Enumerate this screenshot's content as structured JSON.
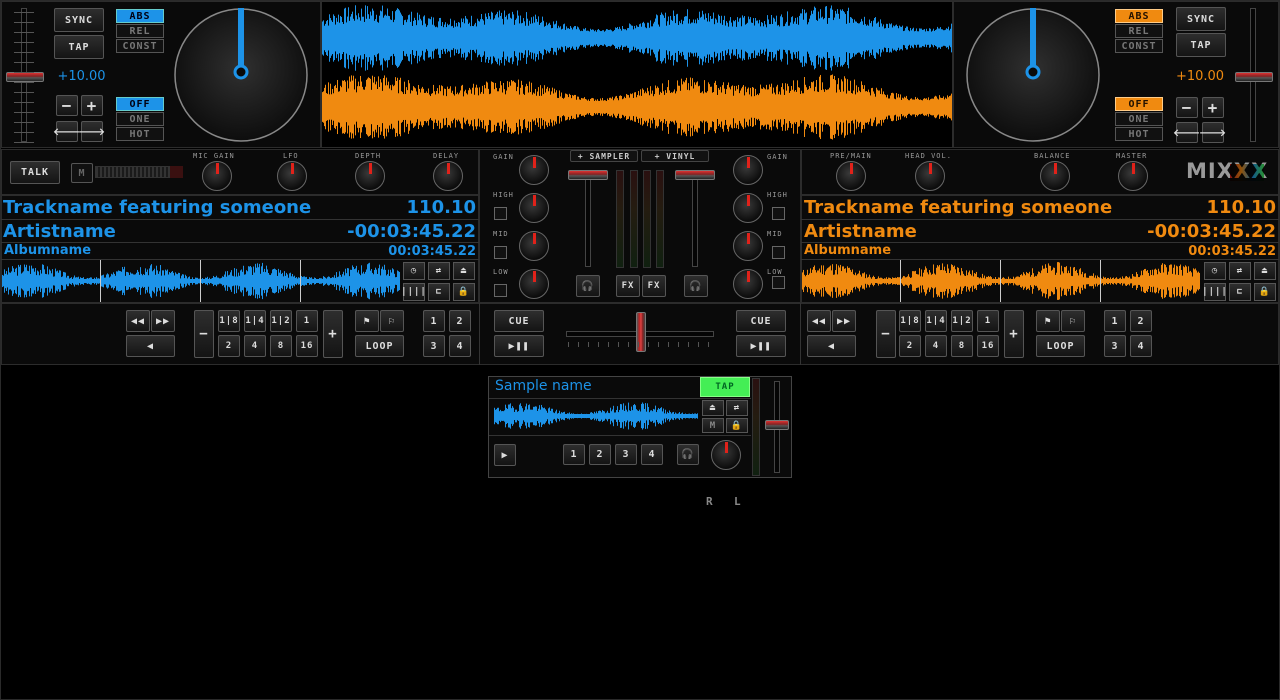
{
  "app": {
    "logo": "MIXXX"
  },
  "colors": {
    "deck1": "#1d93e8",
    "deck2": "#f08a10",
    "tap_green": "#44ee55"
  },
  "deck1": {
    "sync_label": "SYNC",
    "tap_label": "TAP",
    "rate_modes": [
      "ABS",
      "REL",
      "CONST"
    ],
    "rate_mode_active": "ABS",
    "pitch_value": "+10.00",
    "cue_modes": [
      "OFF",
      "ONE",
      "HOT"
    ],
    "cue_mode_active": "OFF",
    "minus": "−",
    "plus": "+",
    "track": "Trackname featuring someone",
    "bpm": "110.10",
    "artist": "Artistname",
    "time_remaining": "-00:03:45.22",
    "album": "Albumname",
    "time_total": "00:03:45.22",
    "cue_label": "CUE",
    "beatloop_top": [
      "1|8",
      "1|4",
      "1|2",
      "1"
    ],
    "beatloop_bottom": [
      "2",
      "4",
      "8",
      "16"
    ],
    "loop_label": "LOOP",
    "hotcues": [
      "1",
      "2",
      "3",
      "4"
    ]
  },
  "deck2": {
    "sync_label": "SYNC",
    "tap_label": "TAP",
    "rate_modes": [
      "ABS",
      "REL",
      "CONST"
    ],
    "rate_mode_active": "ABS",
    "pitch_value": "+10.00",
    "cue_modes": [
      "OFF",
      "ONE",
      "HOT"
    ],
    "cue_mode_active": "OFF",
    "minus": "−",
    "plus": "+",
    "track": "Trackname featuring someone",
    "bpm": "110.10",
    "artist": "Artistname",
    "time_remaining": "-00:03:45.22",
    "album": "Albumname",
    "time_total": "00:03:45.22",
    "cue_label": "CUE",
    "beatloop_top": [
      "1|8",
      "1|4",
      "1|2",
      "1"
    ],
    "beatloop_bottom": [
      "2",
      "4",
      "8",
      "16"
    ],
    "loop_label": "LOOP",
    "hotcues": [
      "1",
      "2",
      "3",
      "4"
    ]
  },
  "mic": {
    "talk_label": "TALK",
    "m_label": "M",
    "knobs": [
      "MIC GAIN",
      "LFO",
      "DEPTH",
      "DELAY"
    ]
  },
  "master": {
    "knobs": [
      "PRE/MAIN",
      "HEAD VOL.",
      "BALANCE",
      "MASTER"
    ]
  },
  "mixer": {
    "sampler_toggle": "+ SAMPLER",
    "vinyl_toggle": "+ VINYL",
    "left_labels": [
      "GAIN",
      "HIGH",
      "MID",
      "LOW"
    ],
    "right_labels": [
      "GAIN",
      "HIGH",
      "MID",
      "LOW"
    ],
    "fx_label": "FX"
  },
  "sampler": {
    "name": "Sample name",
    "tap_label": "TAP",
    "m_label": "M",
    "hotcues": [
      "1",
      "2",
      "3",
      "4"
    ]
  },
  "orientation": {
    "r": "R",
    "l": "L"
  }
}
